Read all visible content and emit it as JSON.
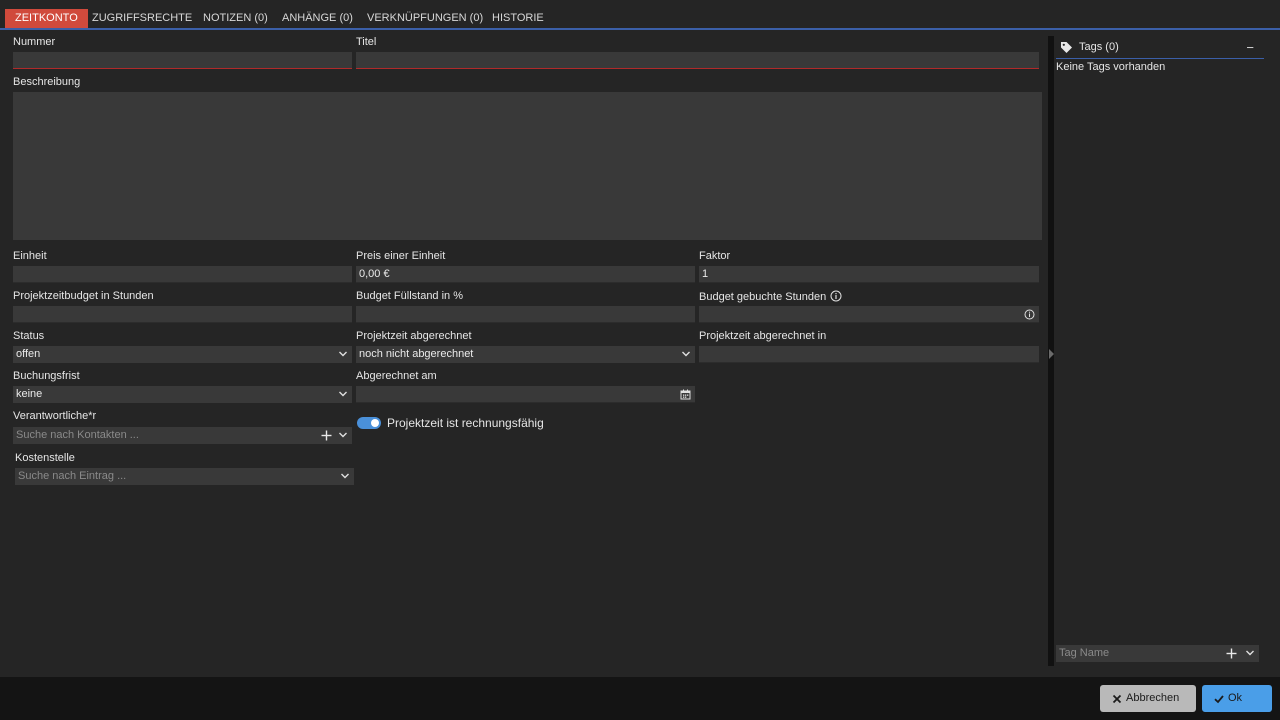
{
  "tabs": [
    {
      "label": "ZEITKONTO",
      "active": true
    },
    {
      "label": "ZUGRIFFSRECHTE"
    },
    {
      "label": "NOTIZEN (0)"
    },
    {
      "label": "ANHÄNGE (0)"
    },
    {
      "label": "VERKNÜPFUNGEN (0)"
    },
    {
      "label": "HISTORIE"
    }
  ],
  "form": {
    "nummer": {
      "label": "Nummer",
      "value": ""
    },
    "titel": {
      "label": "Titel",
      "value": ""
    },
    "beschreibung": {
      "label": "Beschreibung",
      "value": ""
    },
    "einheit": {
      "label": "Einheit",
      "value": ""
    },
    "preis": {
      "label": "Preis einer Einheit",
      "value": "0,00 €"
    },
    "faktor": {
      "label": "Faktor",
      "value": "1"
    },
    "budget_stunden": {
      "label": "Projektzeitbudget in Stunden",
      "value": ""
    },
    "budget_fuellstand": {
      "label": "Budget Füllstand in %",
      "value": ""
    },
    "budget_gebucht": {
      "label": "Budget gebuchte Stunden",
      "value": ""
    },
    "status": {
      "label": "Status",
      "value": "offen"
    },
    "abgerechnet": {
      "label": "Projektzeit abgerechnet",
      "value": "noch nicht abgerechnet"
    },
    "abgerechnet_in": {
      "label": "Projektzeit abgerechnet in",
      "value": ""
    },
    "buchungsfrist": {
      "label": "Buchungsfrist",
      "value": "keine"
    },
    "abgerechnet_am": {
      "label": "Abgerechnet am",
      "value": ""
    },
    "verantwortliche": {
      "label": "Verantwortliche*r",
      "placeholder": "Suche nach Kontakten ..."
    },
    "kostenstelle": {
      "label": "Kostenstelle",
      "placeholder": "Suche nach Eintrag ..."
    },
    "rechnungsfaehig": {
      "label": "Projektzeit ist rechnungsfähig",
      "checked": true
    }
  },
  "tags": {
    "title": "Tags (0)",
    "empty": "Keine Tags vorhanden",
    "input_placeholder": "Tag Name",
    "collapse_label": "−"
  },
  "footer": {
    "cancel_label": "Abbrechen",
    "ok_label": "Ok"
  },
  "colors": {
    "accent": "#3b5fa8",
    "active_tab": "#d04a3c",
    "ok_button": "#4a9ee8",
    "toggle_on": "#4a90d9"
  }
}
